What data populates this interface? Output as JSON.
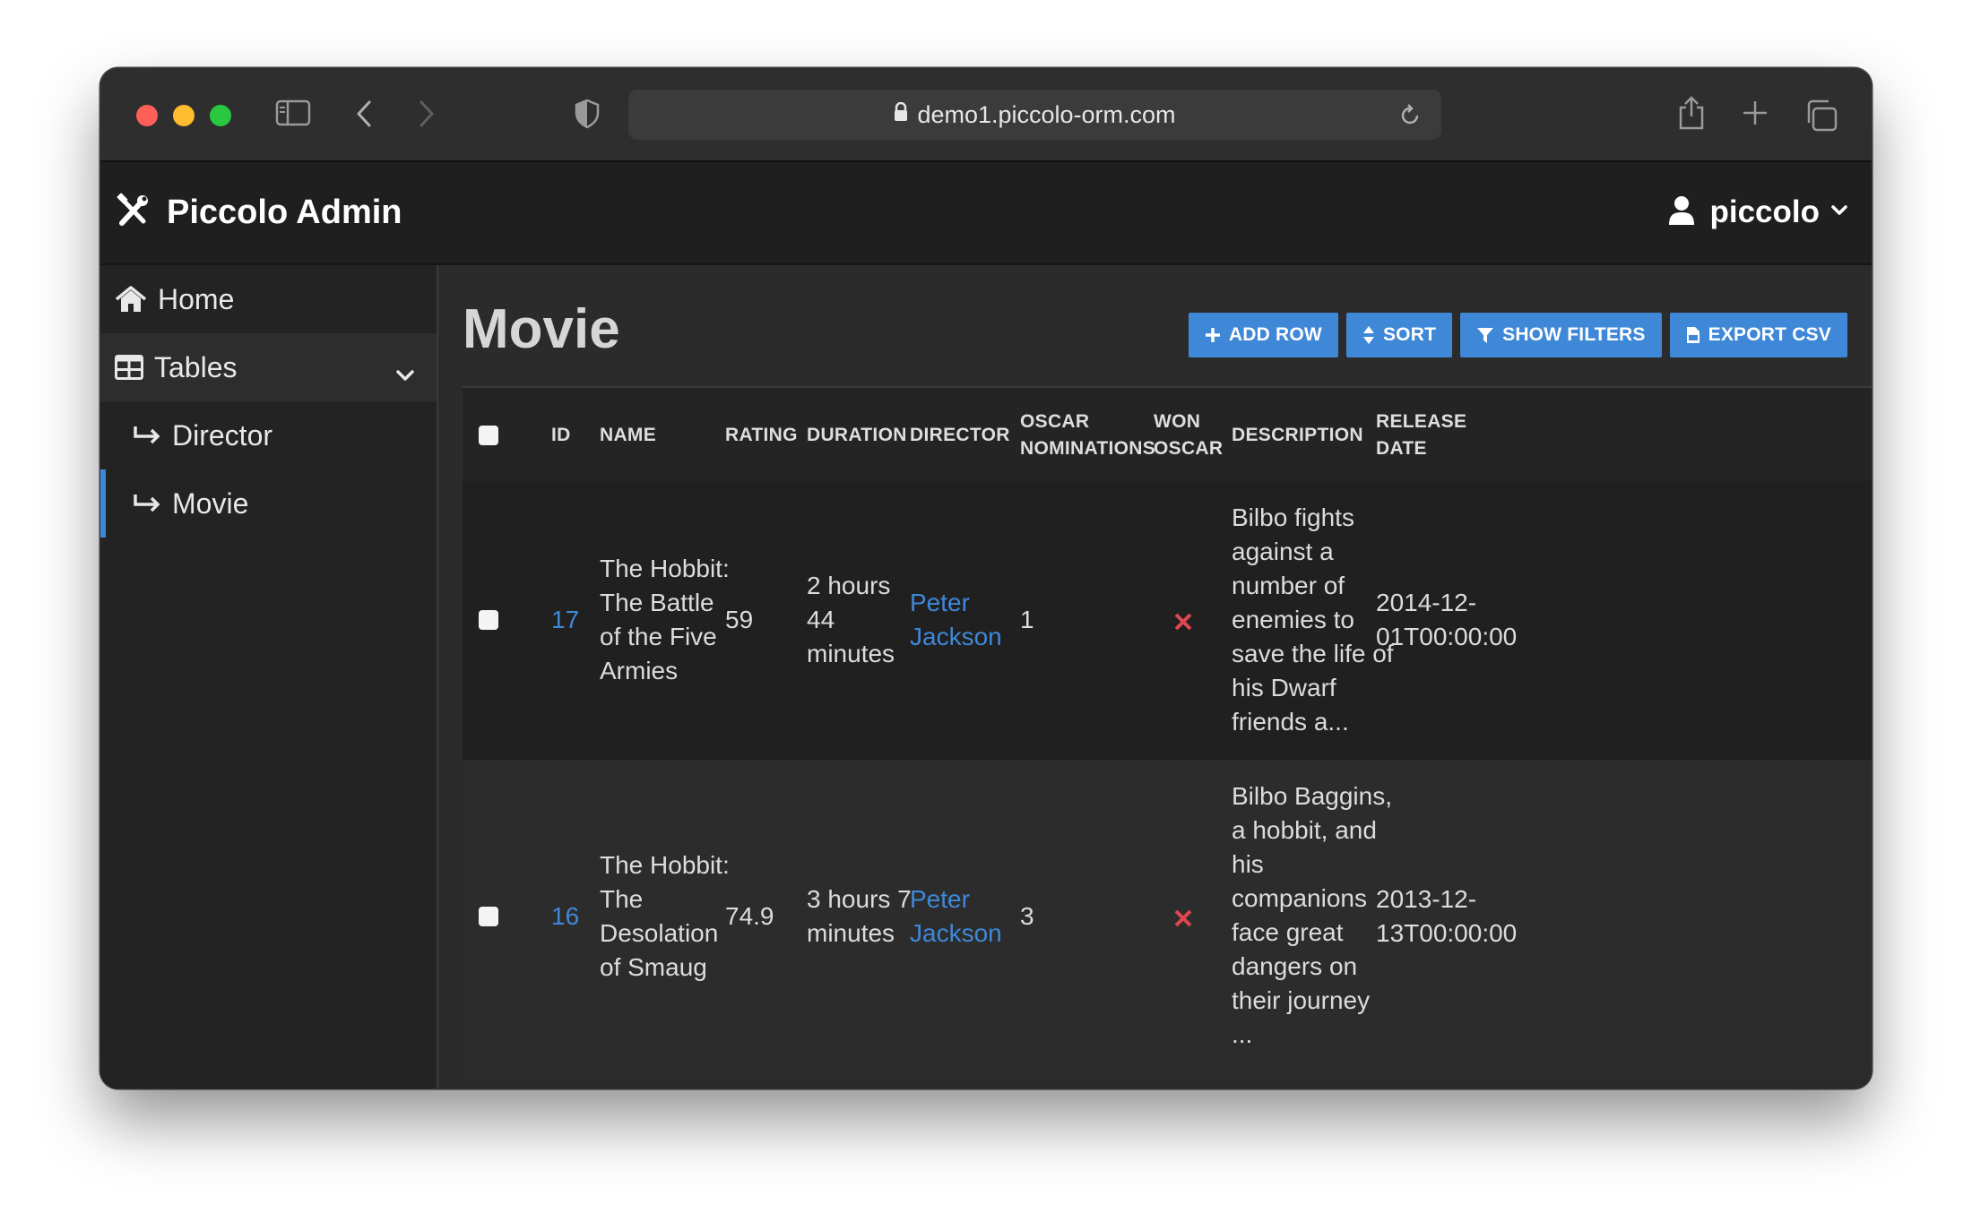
{
  "browser": {
    "url": "demo1.piccolo-orm.com"
  },
  "app": {
    "brand": "Piccolo Admin",
    "user": "piccolo"
  },
  "sidebar": {
    "home": "Home",
    "tables": "Tables",
    "items": [
      {
        "label": "Director",
        "active": false
      },
      {
        "label": "Movie",
        "active": true
      }
    ]
  },
  "page": {
    "title": "Movie",
    "buttons": {
      "add_row": "ADD ROW",
      "sort": "SORT",
      "show_filters": "SHOW FILTERS",
      "export_csv": "EXPORT CSV"
    }
  },
  "table": {
    "headers": {
      "id": "ID",
      "name": "NAME",
      "rating": "RATING",
      "duration": "DURATION",
      "director": "DIRECTOR",
      "oscar_nom_1": "OSCAR",
      "oscar_nom_2": "NOMINATIONS",
      "won_oscar_1": "WON",
      "won_oscar_2": "OSCAR",
      "description": "DESCRIPTION",
      "release_1": "RELEASE",
      "release_2": "DATE"
    },
    "rows": [
      {
        "id": "17",
        "name": [
          "The Hobbit:",
          "The Battle",
          "of the Five",
          "Armies"
        ],
        "rating": "59",
        "duration": [
          "2 hours",
          "44",
          "minutes"
        ],
        "director": [
          "Peter",
          "Jackson"
        ],
        "oscar_nominations": "1",
        "won_oscar": false,
        "description": [
          "Bilbo fights",
          "against a",
          "number of",
          "enemies to",
          "save the life of",
          "his Dwarf",
          "friends a..."
        ],
        "release_date": [
          "2014-12-",
          "01T00:00:00"
        ]
      },
      {
        "id": "16",
        "name": [
          "The Hobbit:",
          "The",
          "Desolation",
          "of Smaug"
        ],
        "rating": "74.9",
        "duration": [
          "3 hours 7",
          "minutes"
        ],
        "director": [
          "Peter",
          "Jackson"
        ],
        "oscar_nominations": "3",
        "won_oscar": false,
        "description": [
          "Bilbo Baggins,",
          "a hobbit, and",
          "his",
          "companions",
          "face great",
          "dangers on",
          "their journey",
          "..."
        ],
        "release_date": [
          "2013-12-",
          "13T00:00:00"
        ]
      }
    ]
  },
  "colors": {
    "accent": "#3f88d8",
    "cross": "#e0474c"
  },
  "icons": [
    "sidebar-icon",
    "back-icon",
    "forward-icon",
    "shield-icon",
    "lock-icon",
    "reload-icon",
    "share-icon",
    "new-tab-icon",
    "tabs-icon",
    "tools-icon",
    "user-icon",
    "chevron-down-icon",
    "home-icon",
    "table-icon",
    "sub-arrow-icon",
    "plus-icon",
    "sort-icon",
    "filter-icon",
    "csv-icon",
    "cross-icon"
  ]
}
